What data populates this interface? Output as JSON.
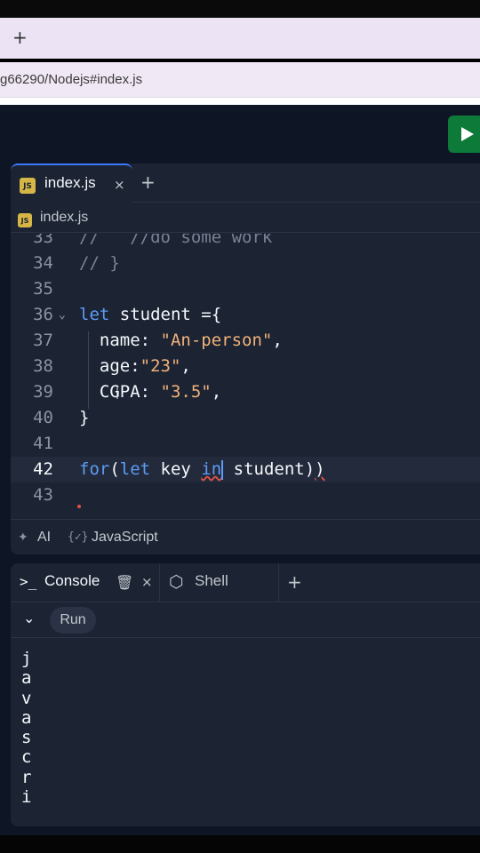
{
  "browser": {
    "new_tab_label": "+",
    "url": "g66290/Nodejs#index.js"
  },
  "editor": {
    "tab_label": "index.js",
    "tab_close": "×",
    "tab_add": "+",
    "breadcrumb": "index.js",
    "file_badge": "JS"
  },
  "status": {
    "ai_label": "AI",
    "language": "JavaScript"
  },
  "console": {
    "console_label": "Console",
    "shell_label": "Shell",
    "run_label": "Run",
    "output": [
      "j",
      "a",
      "v",
      "a",
      "s",
      "c",
      "r",
      "i"
    ]
  },
  "colors": {
    "keyword": "#5c9cf5",
    "string": "#f0b27a",
    "comment": "#7a8294",
    "run_button": "#0d7a3a",
    "panel_bg": "#1c2333",
    "app_bg": "#0e1525"
  },
  "code_lines": [
    {
      "n": "33",
      "tokens": [
        {
          "t": "//   //do some work",
          "c": "comment"
        }
      ]
    },
    {
      "n": "34",
      "tokens": [
        {
          "t": "// }",
          "c": "comment"
        }
      ]
    },
    {
      "n": "35",
      "tokens": []
    },
    {
      "n": "36",
      "fold": true,
      "tokens": [
        {
          "t": "let",
          "c": "kw"
        },
        {
          "t": " student ={",
          "c": "plain"
        }
      ]
    },
    {
      "n": "37",
      "tokens": [
        {
          "t": "  name: ",
          "c": "plain"
        },
        {
          "t": "\"An-person\"",
          "c": "str"
        },
        {
          "t": ",",
          "c": "plain"
        }
      ]
    },
    {
      "n": "38",
      "tokens": [
        {
          "t": "  age:",
          "c": "plain"
        },
        {
          "t": "\"23\"",
          "c": "str"
        },
        {
          "t": ",",
          "c": "plain"
        }
      ]
    },
    {
      "n": "39",
      "tokens": [
        {
          "t": "  CGPA: ",
          "c": "plain"
        },
        {
          "t": "\"3.5\"",
          "c": "str"
        },
        {
          "t": ",",
          "c": "plain"
        }
      ]
    },
    {
      "n": "40",
      "tokens": [
        {
          "t": "}",
          "c": "plain"
        }
      ]
    },
    {
      "n": "41",
      "tokens": []
    },
    {
      "n": "42",
      "active": true,
      "tokens": [
        {
          "t": "for",
          "c": "kw"
        },
        {
          "t": "(",
          "c": "plain"
        },
        {
          "t": "let",
          "c": "kw"
        },
        {
          "t": " key ",
          "c": "plain"
        },
        {
          "t": "in",
          "c": "kw-err"
        },
        {
          "t": "|",
          "c": "cursor"
        },
        {
          "t": " student)",
          "c": "plain"
        },
        {
          "t": ")",
          "c": "plain-err"
        }
      ]
    },
    {
      "n": "43",
      "tokens": []
    }
  ]
}
